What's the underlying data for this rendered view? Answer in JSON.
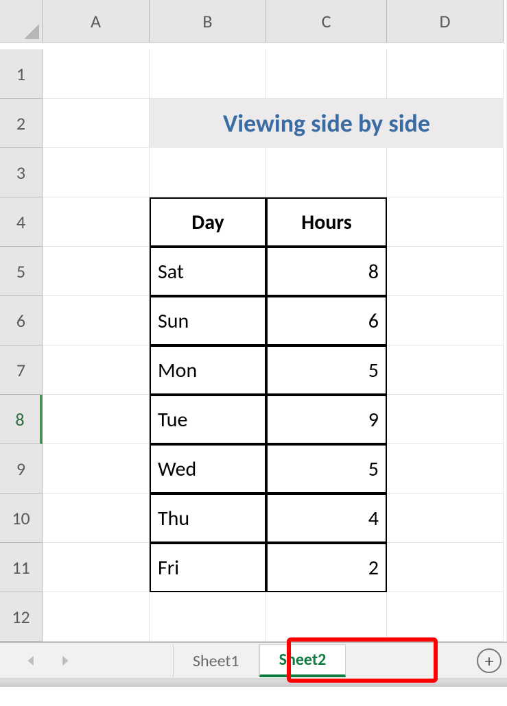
{
  "columns": [
    "A",
    "B",
    "C",
    "D"
  ],
  "rows": [
    "1",
    "2",
    "3",
    "4",
    "5",
    "6",
    "7",
    "8",
    "9",
    "10",
    "11",
    "12"
  ],
  "active_row_header": "8",
  "title": "Viewing side by side",
  "table": {
    "headers": [
      "Day",
      "Hours"
    ],
    "data": [
      {
        "day": "Sat",
        "hours": "8"
      },
      {
        "day": "Sun",
        "hours": "6"
      },
      {
        "day": "Mon",
        "hours": "5"
      },
      {
        "day": "Tue",
        "hours": "9"
      },
      {
        "day": "Wed",
        "hours": "5"
      },
      {
        "day": "Thu",
        "hours": "4"
      },
      {
        "day": "Fri",
        "hours": "2"
      }
    ]
  },
  "tabs": {
    "items": [
      {
        "label": "Sheet1",
        "active": false
      },
      {
        "label": "Sheet2",
        "active": true
      }
    ],
    "highlighted": "Sheet2"
  }
}
